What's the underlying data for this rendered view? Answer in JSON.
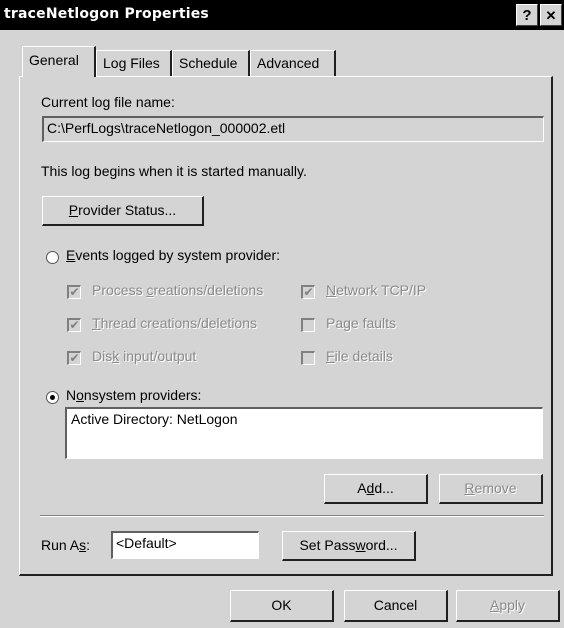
{
  "window": {
    "title": "traceNetlogon Properties",
    "help_glyph": "?",
    "close_glyph": "✕"
  },
  "tabs": [
    {
      "label": "General",
      "active": true
    },
    {
      "label": "Log Files",
      "active": false
    },
    {
      "label": "Schedule",
      "active": false
    },
    {
      "label": "Advanced",
      "active": false
    }
  ],
  "general": {
    "current_log_label": "Current log file name:",
    "current_log_value": "C:\\PerfLogs\\traceNetlogon_000002.etl",
    "log_begins_text": "This log begins when it is started manually.",
    "provider_status_button": {
      "pre": "",
      "key": "P",
      "post": "rovider Status..."
    },
    "events_radio": {
      "pre": "",
      "key": "E",
      "post": "vents logged by system provider:",
      "selected": false
    },
    "checkboxes": [
      {
        "pre": "Process ",
        "key": "c",
        "post": "reations/deletions",
        "checked": true,
        "enabled": false
      },
      {
        "pre": "",
        "key": "T",
        "post": "hread creations/deletions",
        "checked": true,
        "enabled": false
      },
      {
        "pre": "Dis",
        "key": "k",
        "post": " input/output",
        "checked": true,
        "enabled": false
      },
      {
        "pre": "",
        "key": "N",
        "post": "etwork TCP/IP",
        "checked": true,
        "enabled": false
      },
      {
        "pre": "Page faults",
        "key": "",
        "post": "",
        "checked": false,
        "enabled": false
      },
      {
        "pre": "",
        "key": "F",
        "post": "ile details",
        "checked": false,
        "enabled": false
      }
    ],
    "nonsystem_radio": {
      "pre": "N",
      "key": "o",
      "post": "nsystem providers:",
      "selected": true
    },
    "providers_list": [
      "Active Directory: NetLogon"
    ],
    "add_button": {
      "pre": "A",
      "key": "d",
      "post": "d..."
    },
    "remove_button": {
      "pre": "",
      "key": "R",
      "post": "emove"
    },
    "run_as_label": {
      "pre": "Run A",
      "key": "s",
      "post": ":"
    },
    "run_as_value": "<Default>",
    "set_password_button": {
      "pre": "Set Pass",
      "key": "w",
      "post": "ord..."
    }
  },
  "footer": {
    "ok": "OK",
    "cancel": "Cancel",
    "apply": {
      "pre": "",
      "key": "A",
      "post": "pply"
    }
  },
  "check_glyph": "✔"
}
